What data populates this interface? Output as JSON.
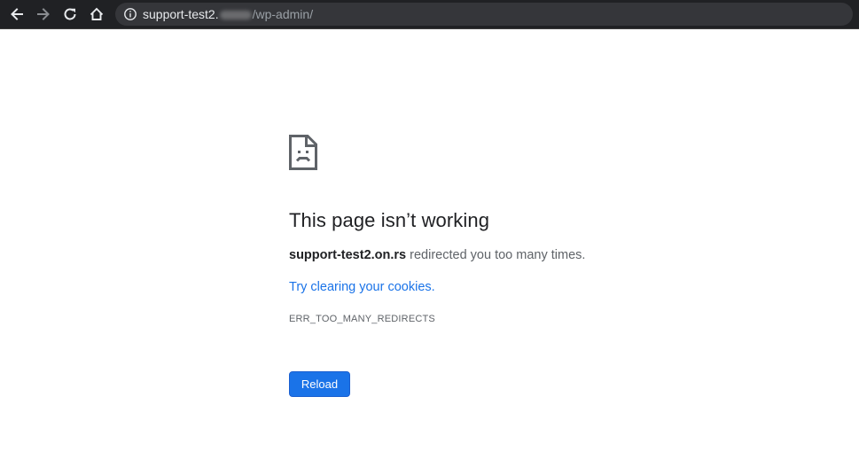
{
  "browser": {
    "url_host": "support-test2.",
    "url_path": "/wp-admin/",
    "icons": {
      "back": "arrow-left-icon",
      "forward": "arrow-right-icon",
      "reload": "reload-icon",
      "home": "home-icon",
      "site_info": "info-icon"
    },
    "colors": {
      "toolbar_bg": "#202124",
      "omnibox_bg": "#35363a"
    }
  },
  "error_page": {
    "icon": "sad-page-icon",
    "title": "This page isn’t working",
    "message_host": "support-test2.on.rs",
    "message_text": " redirected you too many times.",
    "suggestion_link": "Try clearing your cookies",
    "suggestion_period": ".",
    "error_code": "ERR_TOO_MANY_REDIRECTS",
    "reload_label": "Reload",
    "colors": {
      "title": "#202124",
      "link": "#1a73e8",
      "button": "#1a73e8"
    }
  }
}
